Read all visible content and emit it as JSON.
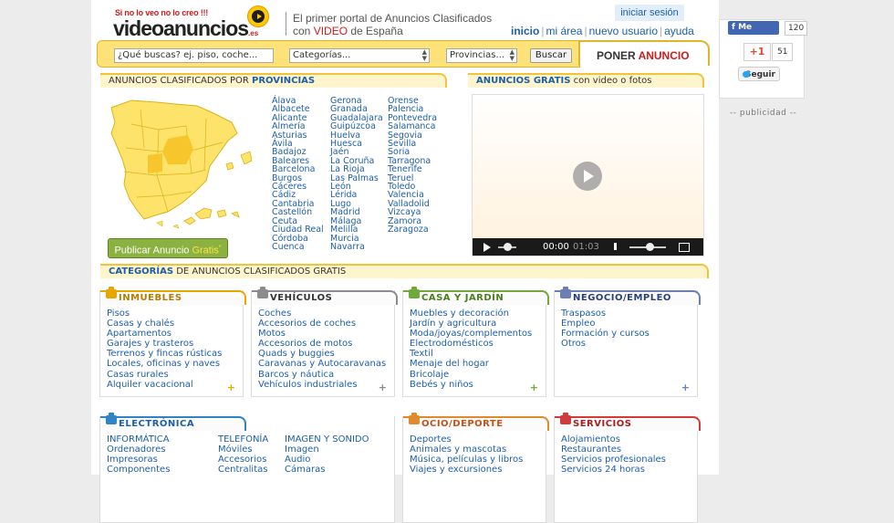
{
  "header": {
    "tagline_small": "Si no lo veo no lo creo !!!",
    "logo_video": "video",
    "logo_anuncios": "anuncios",
    "logo_es": ".es",
    "slogan_line1": "El primer portal de Anuncios Clasificados",
    "slogan_con": "con ",
    "slogan_video": "VIDEO",
    "slogan_end": " de España",
    "login": "iniciar sesión",
    "nav": [
      "inicio",
      "mi área",
      "nuevo usuario",
      "ayuda"
    ]
  },
  "search": {
    "query_placeholder": "¿Qué buscas? ej. piso, coche...",
    "category_selected": "Categorías...",
    "province_selected": "Provincias...",
    "button": "Buscar",
    "post_ad_prefix": "PONER ",
    "post_ad_word": "ANUNCIO"
  },
  "provinces_section": {
    "title_prefix": "ANUNCIOS CLASIFICADOS POR ",
    "title_bold": "PROVINCIAS",
    "columns": [
      [
        "Álava",
        "Albacete",
        "Alicante",
        "Almería",
        "Asturias",
        "Ávila",
        "Badajoz",
        "Baleares",
        "Barcelona",
        "Burgos",
        "Cáceres",
        "Cádiz",
        "Cantabria",
        "Castellón",
        "Ceuta",
        "Ciudad Real",
        "Córdoba",
        "Cuenca"
      ],
      [
        "Gerona",
        "Granada",
        "Guadalajara",
        "Guipúzcoa",
        "Huelva",
        "Huesca",
        "Jaén",
        "La Coruña",
        "La Rioja",
        "Las Palmas",
        "León",
        "Lérida",
        "Lugo",
        "Madrid",
        "Málaga",
        "Melilla",
        "Murcia",
        "Navarra"
      ],
      [
        "Orense",
        "Palencia",
        "Pontevedra",
        "Salamanca",
        "Segovia",
        "Sevilla",
        "Soria",
        "Tarragona",
        "Tenerife",
        "Teruel",
        "Toledo",
        "Valencia",
        "Valladolid",
        "Vizcaya",
        "Zamora",
        "Zaragoza"
      ]
    ],
    "publish_prefix": "Publicar Anuncio ",
    "publish_gratis": "Gratis",
    "publish_sup": "*"
  },
  "video_section": {
    "title_bold": "ANUNCIOS GRATIS",
    "title_rest": " con video o fotos",
    "time_current": "00:00",
    "time_total": "01:03"
  },
  "categories_section": {
    "title_bold": "CATEGORÍAS",
    "title_rest": " DE ANUNCIOS CLASIFICADOS GRATIS",
    "boxes": [
      {
        "title": "INMUEBLES",
        "color": "#e6a800",
        "text": "#b57d00",
        "icon": "house-icon",
        "plus": "+",
        "links": [
          "Pisos",
          "Casas y chalés",
          "Apartamentos",
          "Garajes y trasteros",
          "Terrenos y fincas rústicas",
          "Locales, oficinas y naves",
          "Casas rurales",
          "Alquiler vacacional"
        ]
      },
      {
        "title": "VEHÍCULOS",
        "color": "#8c8c8c",
        "text": "#333333",
        "icon": "car-icon",
        "plus": "+",
        "links": [
          "Coches",
          "Accesorios de coches",
          "Motos",
          "Accesorios de motos",
          "Quads y buggies",
          "Caravanas y Autocaravanas",
          "Barcos y náutica",
          "Vehículos industriales"
        ]
      },
      {
        "title": "CASA Y JARDÍN",
        "color": "#6fa83b",
        "text": "#4a7f1d",
        "icon": "tree-icon",
        "plus": "+",
        "links": [
          "Muebles y decoración",
          "Jardín y agricultura",
          "Moda/joyas/complementos",
          "Electrodomésticos",
          "Textil",
          "Menaje del hogar",
          "Bricolaje",
          "Bebés y niños"
        ]
      },
      {
        "title": "NEGOCIO/EMPLEO",
        "color": "#6b7fb5",
        "text": "#2b3f78",
        "icon": "people-icon",
        "plus": "+",
        "links": [
          "Traspasos",
          "Empleo",
          "Formación y cursos",
          "Otros"
        ]
      },
      {
        "title": "ELECTRÓNICA",
        "color": "#2f84c6",
        "text": "#1d5fa8",
        "icon": "ipod-icon",
        "links": [
          "INFORMÁTICA",
          "Ordenadores",
          "Impresoras",
          "Componentes"
        ],
        "links2": [
          "TELEFONÍA",
          "Móviles",
          "Accesorios",
          "Centralitas"
        ],
        "links3": [
          "IMAGEN Y SONIDO",
          "Imagen",
          "Audio",
          "Cámaras"
        ]
      },
      {
        "title": "OCIO/DEPORTE",
        "color": "#e08a2c",
        "text": "#c2521a",
        "icon": "ticket-icon",
        "links": [
          "Deportes",
          "Animales y mascotas",
          "Música, películas y libros",
          "Viajes y excursiones"
        ]
      },
      {
        "title": "SERVICIOS",
        "color": "#d13b3b",
        "text": "#a51e1e",
        "icon": "spain-map-icon",
        "links": [
          "Alojamientos",
          "Restaurantes",
          "Servicios profesionales",
          "Servicios 24 horas"
        ]
      }
    ]
  },
  "social": {
    "fb_label": "Me gusta",
    "fb_count": "120",
    "gplus_label": "+1",
    "gplus_count": "51",
    "twitter_label": "Seguir"
  },
  "ad_label": "-- publicidad --"
}
